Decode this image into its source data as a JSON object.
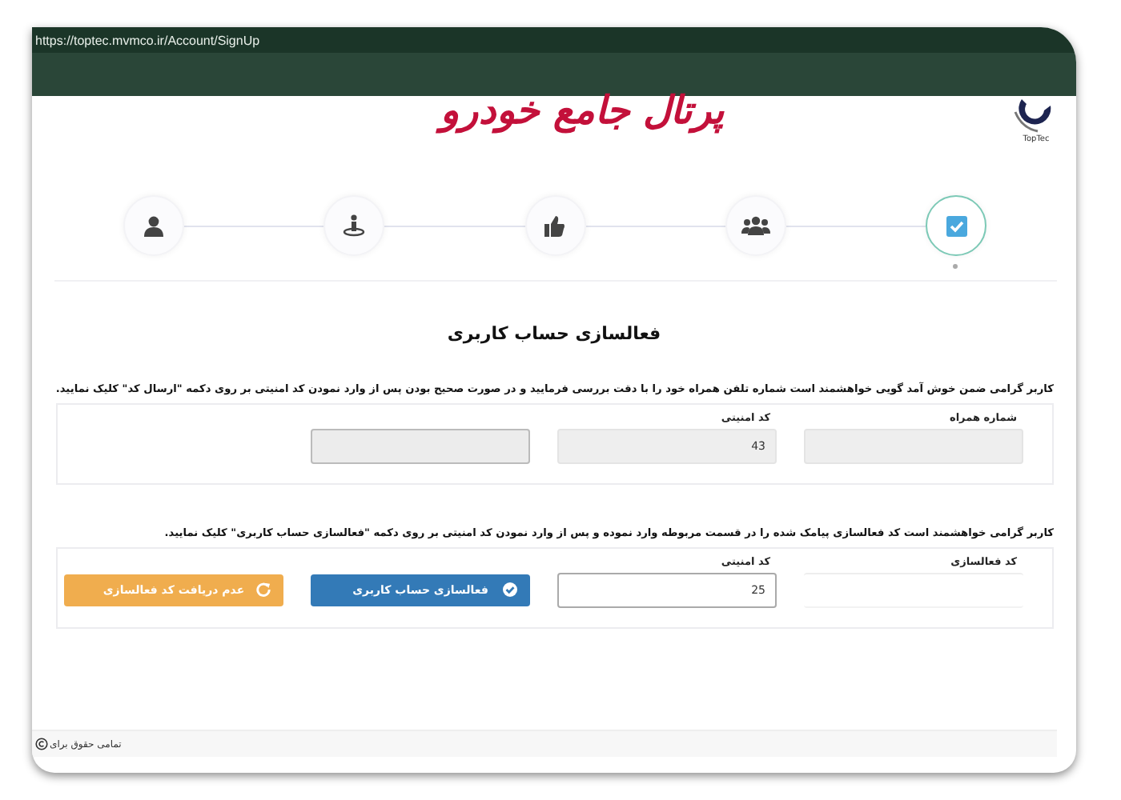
{
  "browser": {
    "url": "https://toptec.mvmco.ir/Account/SignUp"
  },
  "header": {
    "title": "پرتال جامع خودرو",
    "logo_text": "TopTec"
  },
  "steps": [
    {
      "kind": "user",
      "selected": false
    },
    {
      "kind": "spot",
      "selected": false
    },
    {
      "kind": "like",
      "selected": false
    },
    {
      "kind": "group",
      "selected": false
    },
    {
      "kind": "done",
      "selected": true
    }
  ],
  "heading": "فعالسازی حساب کاربری",
  "sections": [
    {
      "instruction": "کاربر گرامی ضمن خوش آمد گویی خواهشمند است شماره تلفن همراه خود را با دقت بررسی فرمایید و در صورت صحیح بودن پس از وارد نمودن کد امنیتی بر روی دکمه \"ارسال کد\" کلیک نمایید.",
      "items": [
        {
          "kind": "field",
          "label": "شماره همراه",
          "value": "",
          "disabled": true
        },
        {
          "kind": "field",
          "label": "کد امنیتی",
          "value": "43",
          "disabled": true
        },
        {
          "kind": "captcha"
        }
      ]
    },
    {
      "instruction": "کاربر گرامی خواهشمند است کد فعالسازی پیامک شده را در قسمت مربوطه وارد نموده و پس از وارد نمودن کد امنیتی بر روی دکمه \"فعالسازی حساب کاربری\" کلیک نمایید.",
      "items": [
        {
          "kind": "plain",
          "label": "کد فعالسازی",
          "value": ""
        },
        {
          "kind": "field",
          "label": "کد امنیتی",
          "value": "25",
          "disabled": false
        },
        {
          "kind": "activate",
          "label": "فعالسازی حساب کاربری"
        },
        {
          "kind": "resend",
          "label": "عدم دریافت کد فعالسازی"
        }
      ]
    }
  ],
  "footer": {
    "text": "تمامی حقوق برای"
  }
}
